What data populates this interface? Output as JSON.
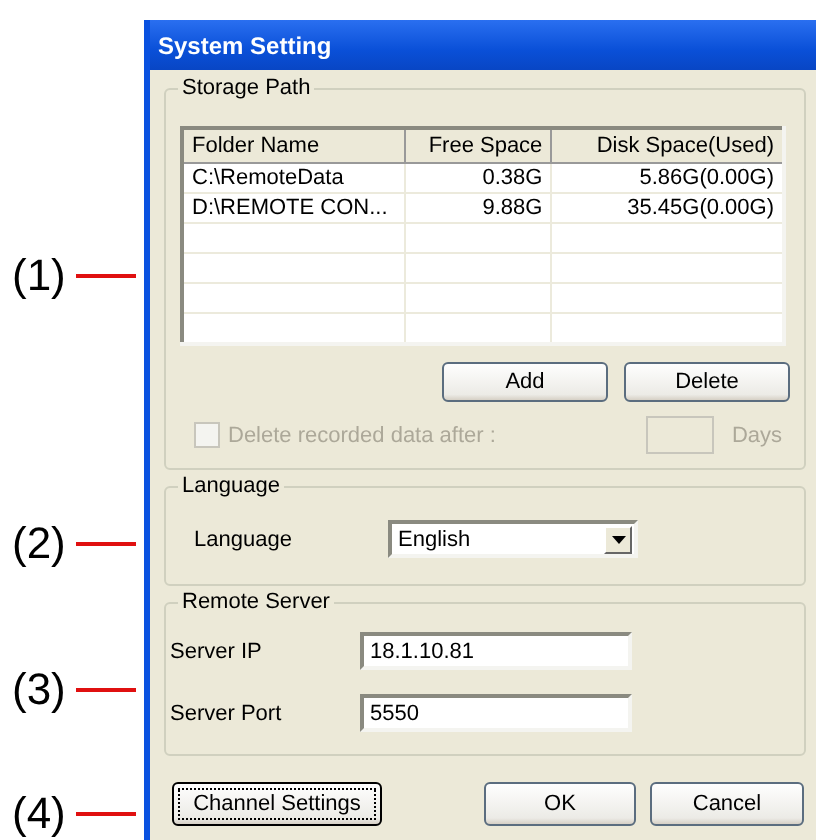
{
  "window": {
    "title": "System Setting"
  },
  "storage_path": {
    "title": "Storage Path",
    "table": {
      "columns": [
        "Folder Name",
        "Free Space",
        "Disk Space(Used)"
      ],
      "rows": [
        [
          "C:\\RemoteData",
          "0.38G",
          "5.86G(0.00G)"
        ],
        [
          "D:\\REMOTE CON...",
          "9.88G",
          "35.45G(0.00G)"
        ]
      ]
    },
    "buttons": [
      "Add",
      "Delete"
    ],
    "delete_after": {
      "label": "Delete recorded data after :",
      "checked": false,
      "disabled": true,
      "unit": "Days"
    }
  },
  "language": {
    "title": "Language",
    "label": "Language",
    "value": "English"
  },
  "remote_server": {
    "title": "Remote Server",
    "fields": [
      {
        "label": "Server IP",
        "value": "18.1.10.81"
      },
      {
        "label": "Server Port",
        "value": "5550"
      }
    ]
  },
  "buttons": [
    {
      "label": "Channel Settings",
      "focused": true
    },
    {
      "label": "OK",
      "focused": false
    },
    {
      "label": "Cancel",
      "focused": false
    }
  ],
  "callouts": [
    "(1)",
    "(2)",
    "(3)",
    "(4)"
  ]
}
